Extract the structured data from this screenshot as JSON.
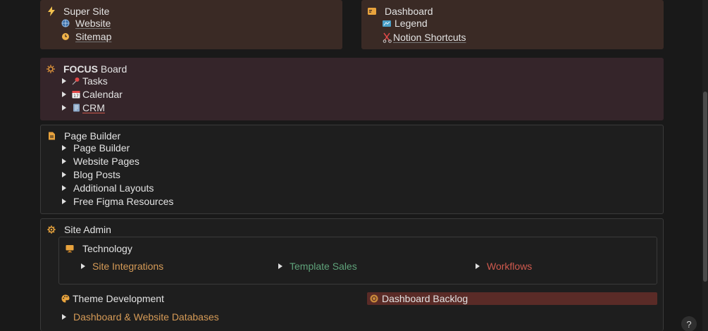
{
  "super_site": {
    "title": "Super Site",
    "items": [
      "Website",
      "Sitemap"
    ]
  },
  "dashboard": {
    "title": "Dashboard",
    "items": [
      "Legend",
      "Notion Shortcuts"
    ]
  },
  "focus_board": {
    "title_bold": "FOCUS",
    "title_rest": " Board",
    "items": [
      "Tasks",
      "Calendar",
      "CRM"
    ]
  },
  "page_builder": {
    "title": "Page Builder",
    "items": [
      "Page Builder",
      "Website Pages",
      "Blog Posts",
      "Additional Layouts",
      "Free Figma Resources"
    ]
  },
  "site_admin": {
    "title": "Site Admin",
    "technology": {
      "title": "Technology",
      "items": [
        "Site Integrations",
        "Template Sales",
        "Workflows"
      ]
    },
    "theme_development": "Theme Development",
    "dashboard_backlog": "Dashboard Backlog",
    "databases": "Dashboard & Website Databases"
  },
  "help": {
    "label": "?"
  },
  "colors": {
    "accent_orange": "#d69b57",
    "accent_green": "#5fa37a",
    "accent_red": "#d05a4e",
    "backlog_bg": "#5a2b27"
  },
  "icons": {
    "super_site": "lightning-icon",
    "website": "globe-icon",
    "sitemap": "clock-icon",
    "dashboard": "dashboard-card-icon",
    "legend": "map-icon",
    "notion_shortcuts": "scissors-icon",
    "focus_board": "sun-icon",
    "tasks": "pushpin-icon",
    "calendar": "calendar-icon",
    "crm": "notebook-icon",
    "page_builder": "document-icon",
    "site_admin": "gear-icon",
    "technology": "monitor-icon",
    "theme_development": "palette-icon",
    "dashboard_backlog": "backlog-icon"
  }
}
